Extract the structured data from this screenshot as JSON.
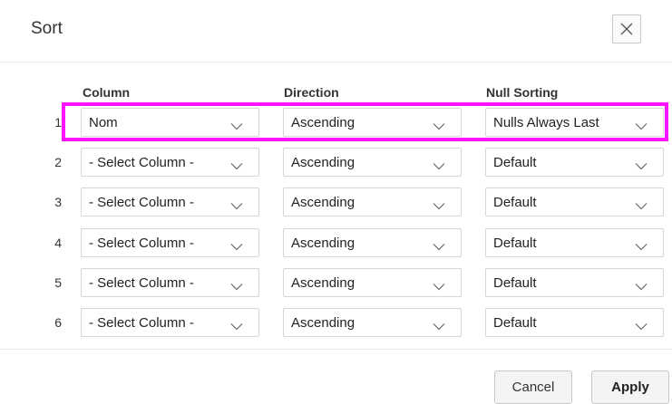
{
  "dialog": {
    "title": "Sort",
    "close_icon": "close-icon"
  },
  "columns": {
    "column": "Column",
    "direction": "Direction",
    "null_sorting": "Null Sorting"
  },
  "rows": [
    {
      "num": "1",
      "column": "Nom",
      "direction": "Ascending",
      "null_sorting": "Nulls Always Last"
    },
    {
      "num": "2",
      "column": "- Select Column -",
      "direction": "Ascending",
      "null_sorting": "Default"
    },
    {
      "num": "3",
      "column": "- Select Column -",
      "direction": "Ascending",
      "null_sorting": "Default"
    },
    {
      "num": "4",
      "column": "- Select Column -",
      "direction": "Ascending",
      "null_sorting": "Default"
    },
    {
      "num": "5",
      "column": "- Select Column -",
      "direction": "Ascending",
      "null_sorting": "Default"
    },
    {
      "num": "6",
      "column": "- Select Column -",
      "direction": "Ascending",
      "null_sorting": "Default"
    }
  ],
  "footer": {
    "cancel_label": "Cancel",
    "apply_label": "Apply"
  },
  "colors": {
    "highlight": "#ff14ff",
    "border": "#d6d6d6"
  },
  "icons": {
    "dropdown": "chevron-down-icon"
  }
}
